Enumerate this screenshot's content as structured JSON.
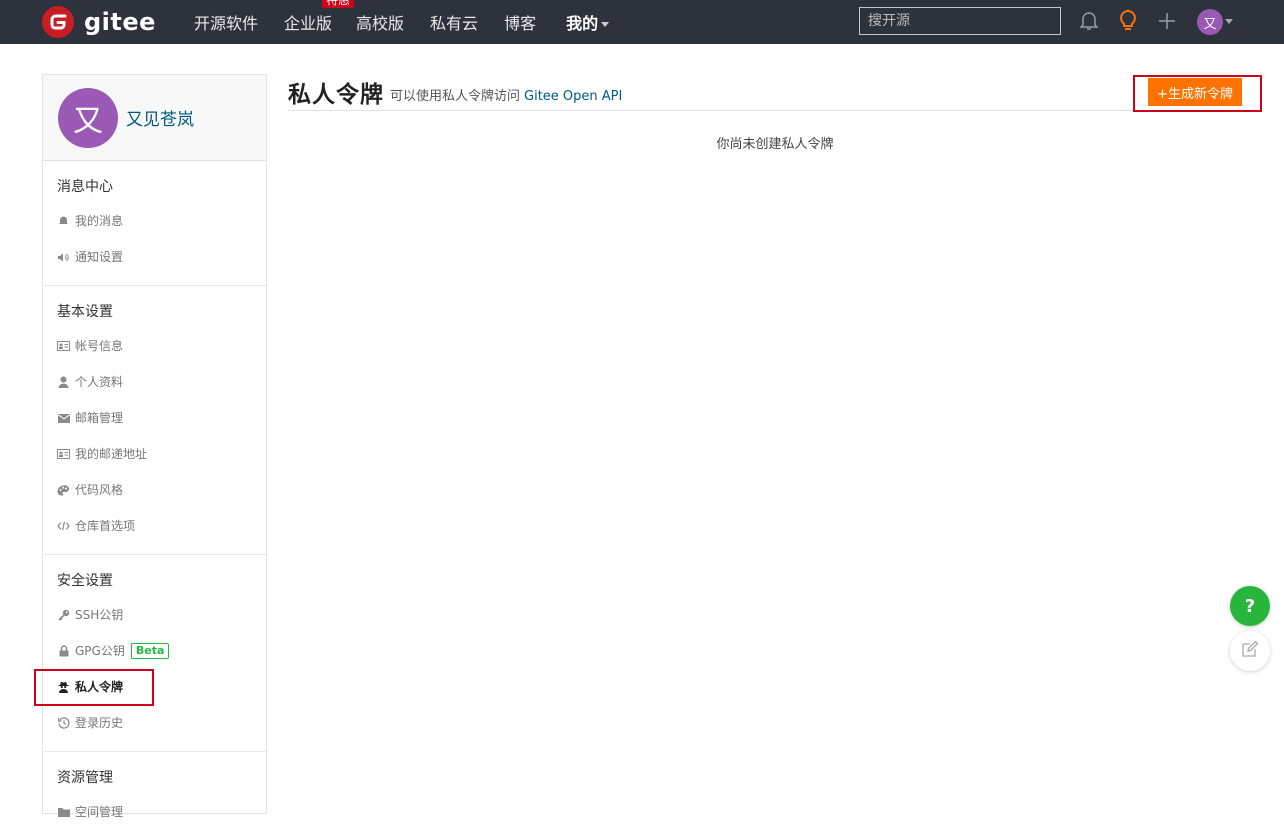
{
  "nav": {
    "logo_text": "gitee",
    "items": [
      {
        "label": "开源软件"
      },
      {
        "label": "企业版",
        "badge": "特惠"
      },
      {
        "label": "高校版"
      },
      {
        "label": "私有云"
      },
      {
        "label": "博客"
      },
      {
        "label": "我的"
      }
    ],
    "search_placeholder": "搜开源",
    "user_initial": "又"
  },
  "colors": {
    "nav_bg": "#2e323d",
    "brand_red": "#c71d23",
    "accent_orange": "#fe7300",
    "link_blue": "#005980",
    "avatar_purple": "#9b59b6",
    "help_green": "#27b53c"
  },
  "sidebar": {
    "user": {
      "initial": "又",
      "name": "又见苍岚"
    },
    "sections": [
      {
        "title": "消息中心",
        "items": [
          {
            "label": "我的消息",
            "icon": "bell-icon"
          },
          {
            "label": "通知设置",
            "icon": "speaker-icon"
          }
        ]
      },
      {
        "title": "基本设置",
        "items": [
          {
            "label": "帐号信息",
            "icon": "id-card-icon"
          },
          {
            "label": "个人资料",
            "icon": "user-icon"
          },
          {
            "label": "邮箱管理",
            "icon": "envelope-icon"
          },
          {
            "label": "我的邮递地址",
            "icon": "address-card-icon"
          },
          {
            "label": "代码风格",
            "icon": "palette-icon"
          },
          {
            "label": "仓库首选项",
            "icon": "code-icon"
          }
        ]
      },
      {
        "title": "安全设置",
        "items": [
          {
            "label": "SSH公钥",
            "icon": "key-icon"
          },
          {
            "label": "GPG公钥",
            "icon": "lock-icon",
            "badge": "Beta"
          },
          {
            "label": "私人令牌",
            "icon": "user-secret-icon",
            "active": true
          },
          {
            "label": "登录历史",
            "icon": "history-icon"
          }
        ]
      },
      {
        "title": "资源管理",
        "items": [
          {
            "label": "空间管理",
            "icon": "folder-icon"
          }
        ]
      }
    ]
  },
  "main": {
    "title": "私人令牌",
    "subtitle": "可以使用私人令牌访问",
    "subtitle_link": "Gitee Open API",
    "generate_button": "+生成新令牌",
    "empty_text": "你尚未创建私人令牌"
  },
  "floating": {
    "help_label": "?"
  }
}
